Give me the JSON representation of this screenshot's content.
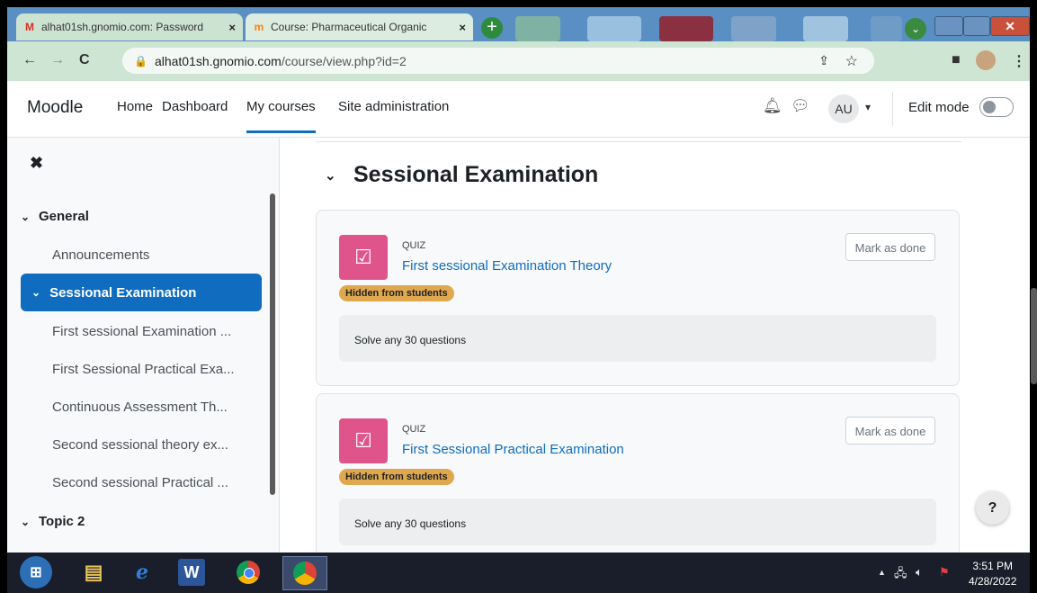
{
  "browser": {
    "tabs": [
      {
        "title": "alhat01sh.gnomio.com: Password",
        "favicon": "gmail-icon",
        "close": "×"
      },
      {
        "title": "Course: Pharmaceutical Organic",
        "favicon": "moodle-icon",
        "close": "×"
      }
    ],
    "new_tab": "+",
    "url_host": "alhat01sh.gnomio.com",
    "url_path": "/course/view.php?id=2"
  },
  "moodle": {
    "brand": "Moodle",
    "nav": [
      "Home",
      "Dashboard",
      "My courses",
      "Site administration"
    ],
    "active_nav": "My courses",
    "user_initials": "AU",
    "edit_mode_label": "Edit mode",
    "edit_mode_on": false
  },
  "course_index": {
    "sections": [
      {
        "label": "General",
        "items": [
          "Announcements"
        ]
      },
      {
        "label": "Sessional Examination",
        "active": true,
        "items": [
          "First sessional Examination ...",
          "First Sessional Practical Exa...",
          "Continuous Assessment Th...",
          "Second sessional theory ex...",
          "Second sessional Practical ..."
        ]
      },
      {
        "label": "Topic 2",
        "items": []
      }
    ]
  },
  "main": {
    "section_title": "Sessional Examination",
    "activities": [
      {
        "type": "QUIZ",
        "name": "First sessional Examination Theory",
        "badge": "Hidden from students",
        "button": "Mark as done",
        "description": "Solve any 30 questions"
      },
      {
        "type": "QUIZ",
        "name": "First Sessional Practical Examination",
        "badge": "Hidden from students",
        "button": "Mark as done",
        "description": "Solve any 30 questions"
      }
    ],
    "help": "?"
  },
  "taskbar": {
    "time": "3:51 PM",
    "date": "4/28/2022"
  }
}
